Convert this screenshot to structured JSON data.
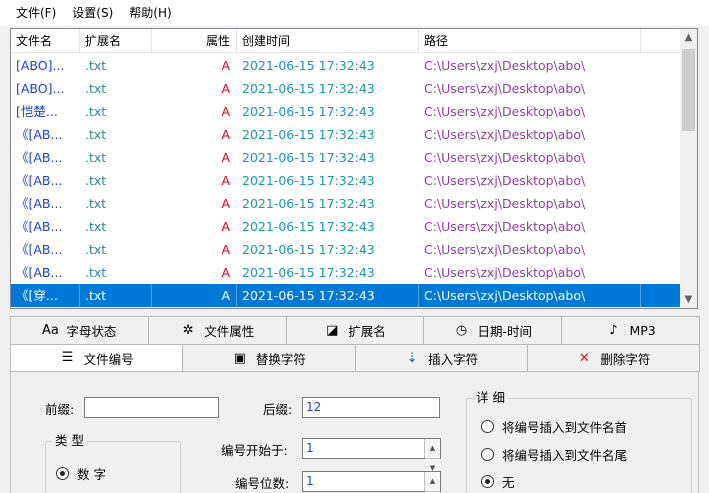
{
  "menu": {
    "file": "文件(F)",
    "settings": "设置(S)",
    "help": "帮助(H)"
  },
  "list": {
    "headers": {
      "name": "文件名",
      "ext": "扩展名",
      "attr": "属性",
      "created": "创建时间",
      "path": "路径"
    },
    "rows": [
      {
        "name": "[ABO]...",
        "ext": ".txt",
        "attr": "A",
        "created": "2021-06-15 17:32:43",
        "path": "C:\\Users\\zxj\\Desktop\\abo\\"
      },
      {
        "name": "[ABO]...",
        "ext": ".txt",
        "attr": "A",
        "created": "2021-06-15 17:32:43",
        "path": "C:\\Users\\zxj\\Desktop\\abo\\"
      },
      {
        "name": "[恺楚...",
        "ext": ".txt",
        "attr": "A",
        "created": "2021-06-15 17:32:43",
        "path": "C:\\Users\\zxj\\Desktop\\abo\\"
      },
      {
        "name": "《[AB...",
        "ext": ".txt",
        "attr": "A",
        "created": "2021-06-15 17:32:43",
        "path": "C:\\Users\\zxj\\Desktop\\abo\\"
      },
      {
        "name": "《[AB...",
        "ext": ".txt",
        "attr": "A",
        "created": "2021-06-15 17:32:43",
        "path": "C:\\Users\\zxj\\Desktop\\abo\\"
      },
      {
        "name": "《[AB...",
        "ext": ".txt",
        "attr": "A",
        "created": "2021-06-15 17:32:43",
        "path": "C:\\Users\\zxj\\Desktop\\abo\\"
      },
      {
        "name": "《[AB...",
        "ext": ".txt",
        "attr": "A",
        "created": "2021-06-15 17:32:43",
        "path": "C:\\Users\\zxj\\Desktop\\abo\\"
      },
      {
        "name": "《[AB...",
        "ext": ".txt",
        "attr": "A",
        "created": "2021-06-15 17:32:43",
        "path": "C:\\Users\\zxj\\Desktop\\abo\\"
      },
      {
        "name": "《[AB...",
        "ext": ".txt",
        "attr": "A",
        "created": "2021-06-15 17:32:43",
        "path": "C:\\Users\\zxj\\Desktop\\abo\\"
      },
      {
        "name": "《[AB...",
        "ext": ".txt",
        "attr": "A",
        "created": "2021-06-15 17:32:43",
        "path": "C:\\Users\\zxj\\Desktop\\abo\\"
      },
      {
        "name": "《[穿...",
        "ext": ".txt",
        "attr": "A",
        "created": "2021-06-15 17:32:43",
        "path": "C:\\Users\\zxj\\Desktop\\abo\\"
      }
    ],
    "selected_index": 10
  },
  "tabs_row1": [
    {
      "icon": "letter-case-icon",
      "glyph": "Aa",
      "label": "字母状态"
    },
    {
      "icon": "gear-icon",
      "glyph": "✲",
      "label": "文件属性"
    },
    {
      "icon": "extension-icon",
      "glyph": "◪",
      "label": "扩展名"
    },
    {
      "icon": "clock-icon",
      "glyph": "◷",
      "label": "日期-时间"
    },
    {
      "icon": "mp3-icon",
      "glyph": "♪",
      "label": "MP3"
    }
  ],
  "tabs_row2": [
    {
      "icon": "list-number-icon",
      "glyph": "☰",
      "label": "文件编号"
    },
    {
      "icon": "replace-icon",
      "glyph": "▣",
      "label": "替换字符"
    },
    {
      "icon": "insert-icon",
      "glyph": "⇣",
      "label": "插入字符"
    },
    {
      "icon": "delete-x-icon",
      "glyph": "✕",
      "label": "删除字符"
    }
  ],
  "active_tab": "文件编号",
  "form": {
    "prefix_label": "前缀:",
    "prefix_value": "",
    "suffix_label": "后缀:",
    "suffix_value": "12",
    "type_group": "类 型",
    "type_numeric": "数 字",
    "start_label": "编号开始于:",
    "start_value": "1",
    "digits_label": "编号位数:",
    "digits_value": "1",
    "detail_group": "详 细",
    "opt_head": "将编号插入到文件名首",
    "opt_tail": "将编号插入到文件名尾",
    "opt_none": "无",
    "detail_selected": "无"
  },
  "colors": {
    "selection": "#0078d7",
    "name_text": "#2040d8",
    "attr_text": "#e0002a",
    "date_text": "#1a9aa8",
    "path_text": "#9040a0"
  }
}
